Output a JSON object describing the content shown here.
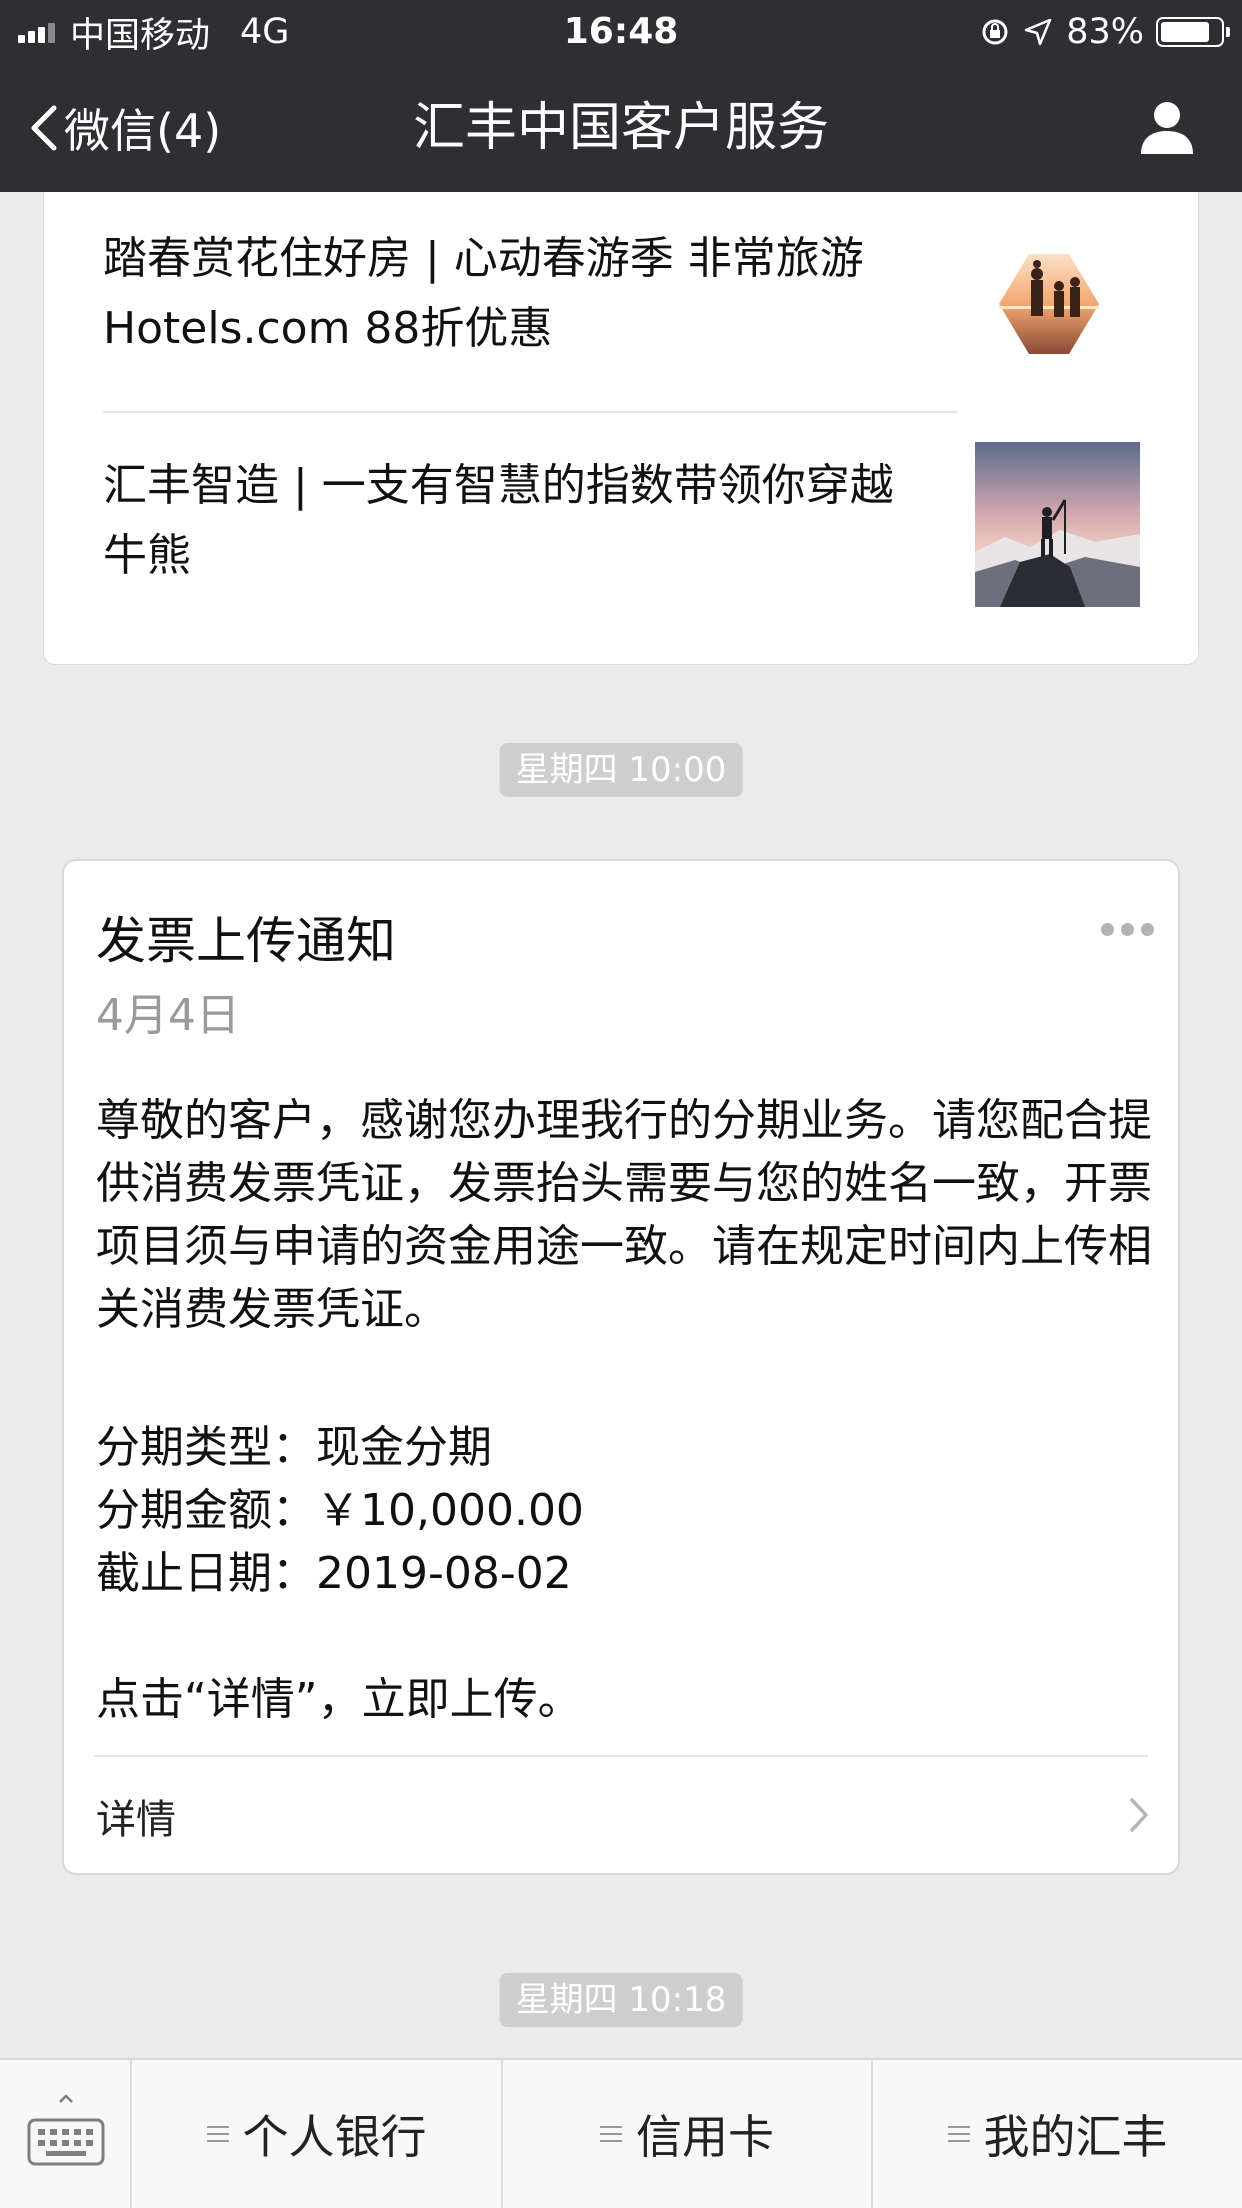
{
  "status_bar": {
    "carrier": "中国移动",
    "network": "4G",
    "time": "16:48",
    "battery": "83%",
    "battery_level": 0.83
  },
  "nav": {
    "back_label": "微信(4)",
    "title": "汇丰中国客户服务"
  },
  "articles": [
    {
      "title": "踏春赏花住好房 | 心动春游季 非常旅游 Hotels.com 88折优惠",
      "thumb": "family-sunset-photo"
    },
    {
      "title": "汇丰智造 | 一支有智慧的指数带领你穿越牛熊",
      "thumb": "hiker-mountain-photo"
    }
  ],
  "timestamps": [
    "星期四 10:00",
    "星期四 10:18"
  ],
  "message": {
    "title": "发票上传通知",
    "date": "4月4日",
    "body": "尊敬的客户，感谢您办理我行的分期业务。请您配合提供消费发票凭证，发票抬头需要与您的姓名一致，开票项目须与申请的资金用途一致。请在规定时间内上传相关消费发票凭证。",
    "fields": [
      {
        "label": "分期类型：",
        "value": "现金分期"
      },
      {
        "label": "分期金额：",
        "value": "￥10,000.00"
      },
      {
        "label": "截止日期：",
        "value": "2019-08-02"
      }
    ],
    "cta": "点击“详情”，立即上传。",
    "detail_label": "详情"
  },
  "menu": {
    "items": [
      "个人银行",
      "信用卡",
      "我的汇丰"
    ]
  },
  "colors": {
    "bar_bg": "#2f2f33",
    "page_bg": "#ebebeb",
    "pill_bg": "#cecece"
  }
}
